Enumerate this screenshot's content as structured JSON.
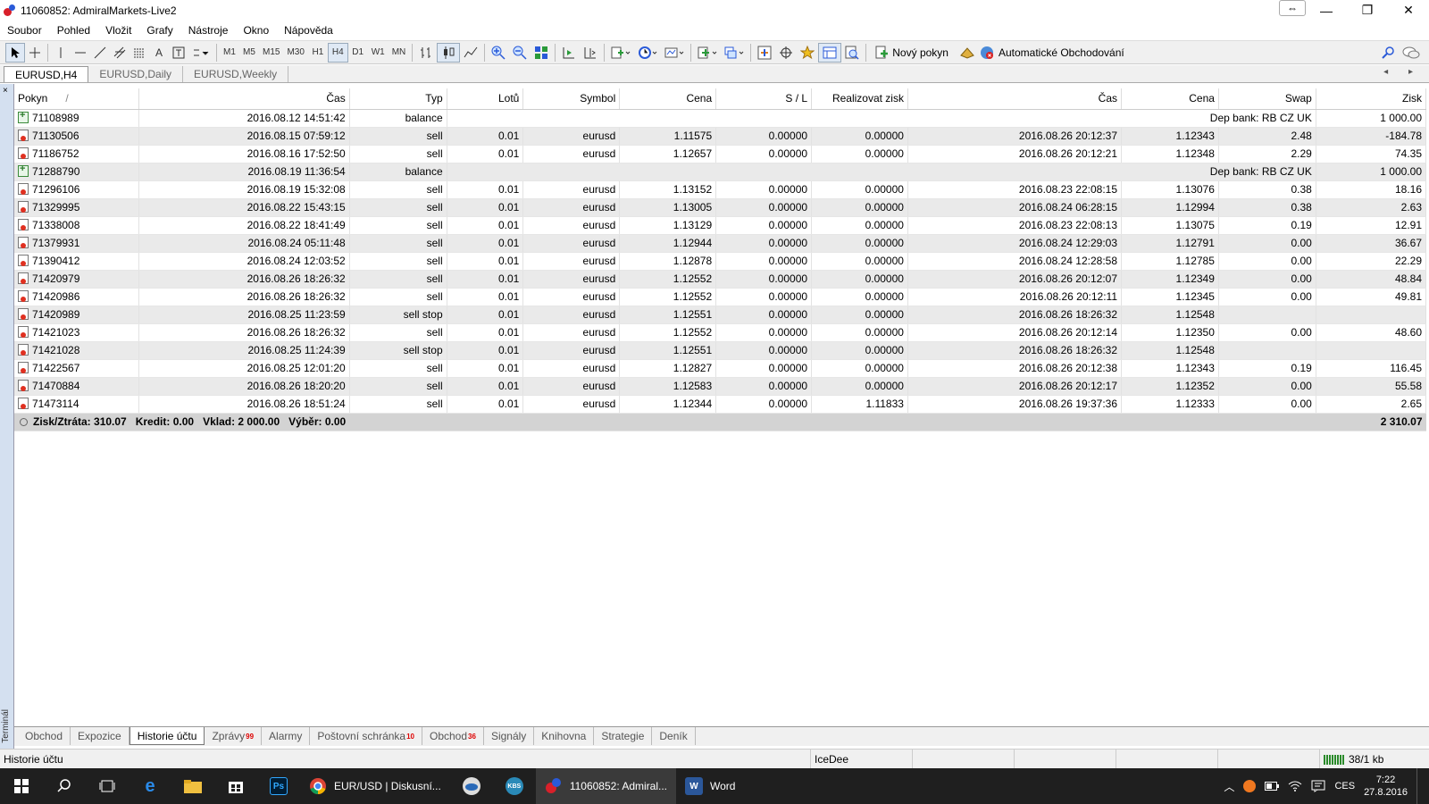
{
  "window": {
    "title": "11060852: AdmiralMarkets-Live2",
    "resize_glyph": "⇔",
    "minimize_glyph": "—",
    "restore_glyph": "❐",
    "close_glyph": "✕"
  },
  "menu": [
    "Soubor",
    "Pohled",
    "Vložit",
    "Grafy",
    "Nástroje",
    "Okno",
    "Nápověda"
  ],
  "toolbar": {
    "timeframes": [
      "M1",
      "M5",
      "M15",
      "M30",
      "H1",
      "H4",
      "D1",
      "W1",
      "MN"
    ],
    "active_timeframe": "H4",
    "new_order_label": "Nový pokyn",
    "auto_trading_label": "Automatické Obchodování"
  },
  "chart_tabs": [
    "EURUSD,H4",
    "EURUSD,Daily",
    "EURUSD,Weekly"
  ],
  "chart_tabs_arrows": "◂ ▸",
  "terminal": {
    "side_label": "Terminál",
    "close_glyph": "×"
  },
  "history": {
    "columns": [
      "Pokyn",
      "Čas",
      "Typ",
      "Lotů",
      "Symbol",
      "Cena",
      "S / L",
      "Realizovat zisk",
      "Čas",
      "Cena",
      "Swap",
      "Zisk"
    ],
    "sort_indicator": "/",
    "rows": [
      {
        "kind": "balance",
        "order": "71108989",
        "time": "2016.08.12 14:51:42",
        "type": "balance",
        "comment": "Dep bank: RB CZ UK",
        "profit": "1 000.00"
      },
      {
        "kind": "order",
        "order": "71130506",
        "time": "2016.08.15 07:59:12",
        "type": "sell",
        "lots": "0.01",
        "symbol": "eurusd",
        "price": "1.11575",
        "sl": "0.00000",
        "tp": "0.00000",
        "close_time": "2016.08.26 20:12:37",
        "close_price": "1.12343",
        "swap": "2.48",
        "profit": "-184.78"
      },
      {
        "kind": "order",
        "order": "71186752",
        "time": "2016.08.16 17:52:50",
        "type": "sell",
        "lots": "0.01",
        "symbol": "eurusd",
        "price": "1.12657",
        "sl": "0.00000",
        "tp": "0.00000",
        "close_time": "2016.08.26 20:12:21",
        "close_price": "1.12348",
        "swap": "2.29",
        "profit": "74.35"
      },
      {
        "kind": "balance",
        "order": "71288790",
        "time": "2016.08.19 11:36:54",
        "type": "balance",
        "comment": "Dep bank: RB CZ UK",
        "profit": "1 000.00"
      },
      {
        "kind": "order",
        "order": "71296106",
        "time": "2016.08.19 15:32:08",
        "type": "sell",
        "lots": "0.01",
        "symbol": "eurusd",
        "price": "1.13152",
        "sl": "0.00000",
        "tp": "0.00000",
        "close_time": "2016.08.23 22:08:15",
        "close_price": "1.13076",
        "swap": "0.38",
        "profit": "18.16"
      },
      {
        "kind": "order",
        "order": "71329995",
        "time": "2016.08.22 15:43:15",
        "type": "sell",
        "lots": "0.01",
        "symbol": "eurusd",
        "price": "1.13005",
        "sl": "0.00000",
        "tp": "0.00000",
        "close_time": "2016.08.24 06:28:15",
        "close_price": "1.12994",
        "swap": "0.38",
        "profit": "2.63"
      },
      {
        "kind": "order",
        "order": "71338008",
        "time": "2016.08.22 18:41:49",
        "type": "sell",
        "lots": "0.01",
        "symbol": "eurusd",
        "price": "1.13129",
        "sl": "0.00000",
        "tp": "0.00000",
        "close_time": "2016.08.23 22:08:13",
        "close_price": "1.13075",
        "swap": "0.19",
        "profit": "12.91"
      },
      {
        "kind": "order",
        "order": "71379931",
        "time": "2016.08.24 05:11:48",
        "type": "sell",
        "lots": "0.01",
        "symbol": "eurusd",
        "price": "1.12944",
        "sl": "0.00000",
        "tp": "0.00000",
        "close_time": "2016.08.24 12:29:03",
        "close_price": "1.12791",
        "swap": "0.00",
        "profit": "36.67"
      },
      {
        "kind": "order",
        "order": "71390412",
        "time": "2016.08.24 12:03:52",
        "type": "sell",
        "lots": "0.01",
        "symbol": "eurusd",
        "price": "1.12878",
        "sl": "0.00000",
        "tp": "0.00000",
        "close_time": "2016.08.24 12:28:58",
        "close_price": "1.12785",
        "swap": "0.00",
        "profit": "22.29"
      },
      {
        "kind": "order",
        "order": "71420979",
        "time": "2016.08.26 18:26:32",
        "type": "sell",
        "lots": "0.01",
        "symbol": "eurusd",
        "price": "1.12552",
        "sl": "0.00000",
        "tp": "0.00000",
        "close_time": "2016.08.26 20:12:07",
        "close_price": "1.12349",
        "swap": "0.00",
        "profit": "48.84"
      },
      {
        "kind": "order",
        "order": "71420986",
        "time": "2016.08.26 18:26:32",
        "type": "sell",
        "lots": "0.01",
        "symbol": "eurusd",
        "price": "1.12552",
        "sl": "0.00000",
        "tp": "0.00000",
        "close_time": "2016.08.26 20:12:11",
        "close_price": "1.12345",
        "swap": "0.00",
        "profit": "49.81"
      },
      {
        "kind": "order",
        "order": "71420989",
        "time": "2016.08.25 11:23:59",
        "type": "sell stop",
        "lots": "0.01",
        "symbol": "eurusd",
        "price": "1.12551",
        "sl": "0.00000",
        "tp": "0.00000",
        "close_time": "2016.08.26 18:26:32",
        "close_price": "1.12548",
        "swap": "",
        "profit": ""
      },
      {
        "kind": "order",
        "order": "71421023",
        "time": "2016.08.26 18:26:32",
        "type": "sell",
        "lots": "0.01",
        "symbol": "eurusd",
        "price": "1.12552",
        "sl": "0.00000",
        "tp": "0.00000",
        "close_time": "2016.08.26 20:12:14",
        "close_price": "1.12350",
        "swap": "0.00",
        "profit": "48.60"
      },
      {
        "kind": "order",
        "order": "71421028",
        "time": "2016.08.25 11:24:39",
        "type": "sell stop",
        "lots": "0.01",
        "symbol": "eurusd",
        "price": "1.12551",
        "sl": "0.00000",
        "tp": "0.00000",
        "close_time": "2016.08.26 18:26:32",
        "close_price": "1.12548",
        "swap": "",
        "profit": ""
      },
      {
        "kind": "order",
        "order": "71422567",
        "time": "2016.08.25 12:01:20",
        "type": "sell",
        "lots": "0.01",
        "symbol": "eurusd",
        "price": "1.12827",
        "sl": "0.00000",
        "tp": "0.00000",
        "close_time": "2016.08.26 20:12:38",
        "close_price": "1.12343",
        "swap": "0.19",
        "profit": "116.45"
      },
      {
        "kind": "order",
        "order": "71470884",
        "time": "2016.08.26 18:20:20",
        "type": "sell",
        "lots": "0.01",
        "symbol": "eurusd",
        "price": "1.12583",
        "sl": "0.00000",
        "tp": "0.00000",
        "close_time": "2016.08.26 20:12:17",
        "close_price": "1.12352",
        "swap": "0.00",
        "profit": "55.58"
      },
      {
        "kind": "order",
        "order": "71473114",
        "time": "2016.08.26 18:51:24",
        "type": "sell",
        "lots": "0.01",
        "symbol": "eurusd",
        "price": "1.12344",
        "sl": "0.00000",
        "tp": "1.11833",
        "close_time": "2016.08.26 19:37:36",
        "close_price": "1.12333",
        "swap": "0.00",
        "profit": "2.65"
      }
    ],
    "summary": {
      "text": "Zisk/Ztráta: 310.07   Kredit: 0.00   Vklad: 2 000.00   Výběr: 0.00",
      "total": "2 310.07"
    }
  },
  "bottom_tabs": [
    {
      "label": "Obchod",
      "badge": ""
    },
    {
      "label": "Expozice",
      "badge": ""
    },
    {
      "label": "Historie účtu",
      "badge": ""
    },
    {
      "label": "Zprávy",
      "badge": "99"
    },
    {
      "label": "Alarmy",
      "badge": ""
    },
    {
      "label": "Poštovní schránka",
      "badge": "10"
    },
    {
      "label": "Obchod",
      "badge": "36"
    },
    {
      "label": "Signály",
      "badge": ""
    },
    {
      "label": "Knihovna",
      "badge": ""
    },
    {
      "label": "Strategie",
      "badge": ""
    },
    {
      "label": "Deník",
      "badge": ""
    }
  ],
  "active_bottom_tab": 2,
  "statusbar": {
    "left": "Historie účtu",
    "profile": "IceDee",
    "traffic": "38/1 kb"
  },
  "taskbar": {
    "apps": [
      {
        "label": "EUR/USD | Diskusní...",
        "icon": "chrome-icon"
      },
      {
        "label": "11060852: Admiral...",
        "icon": "metatrader-icon"
      },
      {
        "label": "Word",
        "icon": "word-icon"
      }
    ],
    "ps_label": "Ps",
    "kbs_label": "KBS",
    "language": "CES",
    "time": "7:22",
    "date": "27.8.2016"
  }
}
